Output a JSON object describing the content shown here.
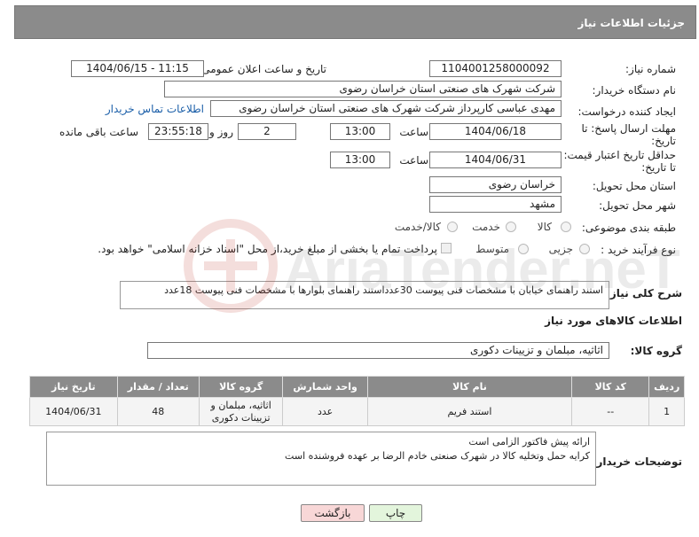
{
  "header": {
    "title": "جزئیات اطلاعات نیاز"
  },
  "form": {
    "need_number": {
      "label": "شماره نیاز:",
      "value": "1104001258000092"
    },
    "announce": {
      "label": "تاریخ و ساعت اعلان عمومی:",
      "value": "1404/06/15 - 11:15"
    },
    "buyer_org": {
      "label": "نام دستگاه خریدار:",
      "value": "شرکت شهرک های صنعتی استان خراسان رضوی"
    },
    "creator": {
      "label": "ایجاد کننده درخواست:",
      "value": "مهدی عباسی کارپرداز شرکت شهرک های صنعتی استان خراسان رضوی",
      "contact_link": "اطلاعات تماس خریدار"
    },
    "deadline": {
      "label_line1": "مهلت ارسال پاسخ: تا",
      "label_line2": "تاریخ:",
      "date": "1404/06/18",
      "time_label": "ساعت",
      "time": "13:00",
      "days": "2",
      "days_label": "روز و",
      "remaining": "23:55:18",
      "remaining_label": "ساعت باقی مانده"
    },
    "price_validity": {
      "label_line1": "حداقل تاریخ اعتبار قیمت:",
      "label_line2": "تا تاریخ:",
      "date": "1404/06/31",
      "time_label": "ساعت",
      "time": "13:00"
    },
    "province": {
      "label": "استان محل تحویل:",
      "value": "خراسان رضوی"
    },
    "city": {
      "label": "شهر محل تحویل:",
      "value": "مشهد"
    },
    "category": {
      "label": "طبقه بندی موضوعی:",
      "options": [
        "کالا",
        "خدمت",
        "کالا/خدمت"
      ]
    },
    "process": {
      "label": "نوع فرآیند خرید :",
      "options": [
        "جزیی",
        "متوسط"
      ],
      "payment_note": "پرداخت تمام یا بخشی از مبلغ خرید،از محل \"اسناد خزانه اسلامی\" خواهد بود."
    }
  },
  "description": {
    "label": "شرح کلی نیاز:",
    "value": "استند راهنمای خیابان با مشخصات فنی پیوست 30عدداستند راهنمای بلوارها با مشخصات فنی پیوست 18عدد"
  },
  "goods_section_title": "اطلاعات کالاهای مورد نیاز",
  "goods_group": {
    "label": "گروه کالا:",
    "value": "اثاثیه، مبلمان و تزیینات دکوری"
  },
  "table": {
    "headers": [
      "ردیف",
      "کد کالا",
      "نام کالا",
      "واحد شمارش",
      "گروه کالا",
      "تعداد / مقدار",
      "تاریخ نیاز"
    ],
    "rows": [
      [
        "1",
        "--",
        "استند فریم",
        "عدد",
        "اثاثیه، مبلمان و تزیینات دکوری",
        "48",
        "1404/06/31"
      ]
    ]
  },
  "buyer_notes": {
    "label": "توضیحات خریدار:",
    "line1": "ارائه پیش فاکتور الزامی است",
    "line2": "کرایه حمل وتخلیه کالا در شهرک صنعتی خادم الرضا بر عهده فروشنده است"
  },
  "buttons": {
    "print": "چاپ",
    "back": "بازگشت"
  },
  "colors": {
    "header_bg": "#8b8b8b",
    "link": "#1a5ea8",
    "back_button_bg": "#f8d7d7",
    "print_button_bg": "#e3f5dc"
  },
  "watermark_text": "AriaTender.neT"
}
